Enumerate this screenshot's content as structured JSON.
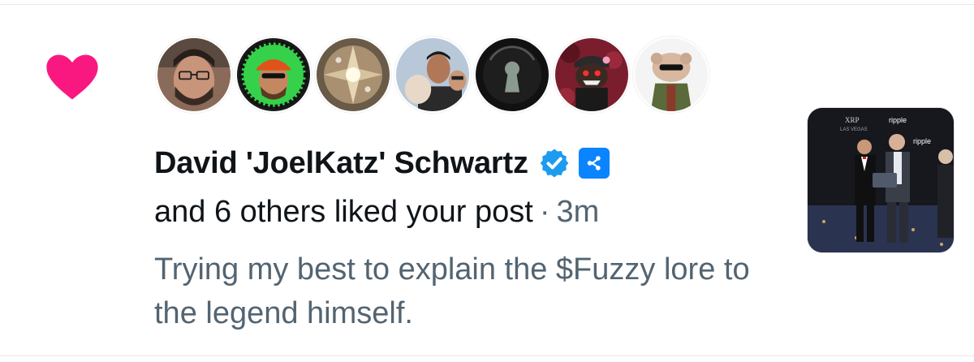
{
  "notification": {
    "type_icon": "heart-icon",
    "avatars": [
      {
        "name": "avatar-1",
        "bg": "#7a5a48"
      },
      {
        "name": "avatar-2",
        "bg": "#2ecc40"
      },
      {
        "name": "avatar-3",
        "bg": "#a89070"
      },
      {
        "name": "avatar-4",
        "bg": "#c9b8a0"
      },
      {
        "name": "avatar-5",
        "bg": "#1a1a1a"
      },
      {
        "name": "avatar-6",
        "bg": "#7a1e2e"
      },
      {
        "name": "avatar-7",
        "bg": "#f2f2f2"
      }
    ],
    "user_name": "David 'JoelKatz' Schwartz",
    "verified_icon": "verified-badge-icon",
    "affiliate_icon": "ripple-affiliate-icon",
    "summary": "and 6 others liked your post",
    "separator": "·",
    "time": "3m",
    "post_text": "Trying my best to explain the $Fuzzy lore to the legend himself.",
    "thumbnail_texts": {
      "brand_1": "ripple",
      "brand_2": "ripple",
      "event": "XRP",
      "location": "LAS VEGAS"
    }
  },
  "colors": {
    "heart": "#f91880",
    "verified": "#1d9bf0",
    "text_primary": "#0f1419",
    "text_secondary": "#536471"
  }
}
